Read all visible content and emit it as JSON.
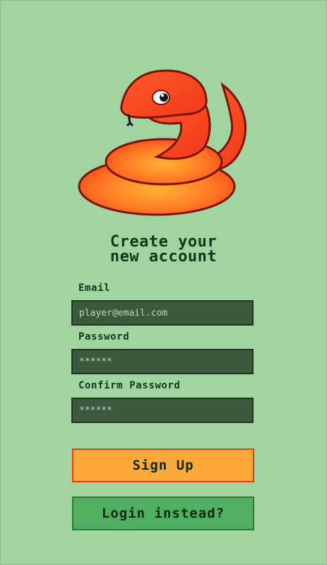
{
  "app": {
    "logo_icon": "snake-icon",
    "colors": {
      "background": "#a1d4a0",
      "text": "#0b3b1a",
      "field_bg": "#3b5a3c",
      "signup_bg": "#fca83b",
      "signup_border": "#f03a17",
      "login_bg": "#51b05f"
    }
  },
  "heading": {
    "line1": "Create your",
    "line2": "new account"
  },
  "form": {
    "email_label": "Email",
    "email_placeholder": "player@email.com",
    "password_label": "Password",
    "password_placeholder": "******",
    "confirm_label": "Confirm Password",
    "confirm_placeholder": "******"
  },
  "buttons": {
    "signup_label": "Sign Up",
    "login_label": "Login instead?"
  }
}
